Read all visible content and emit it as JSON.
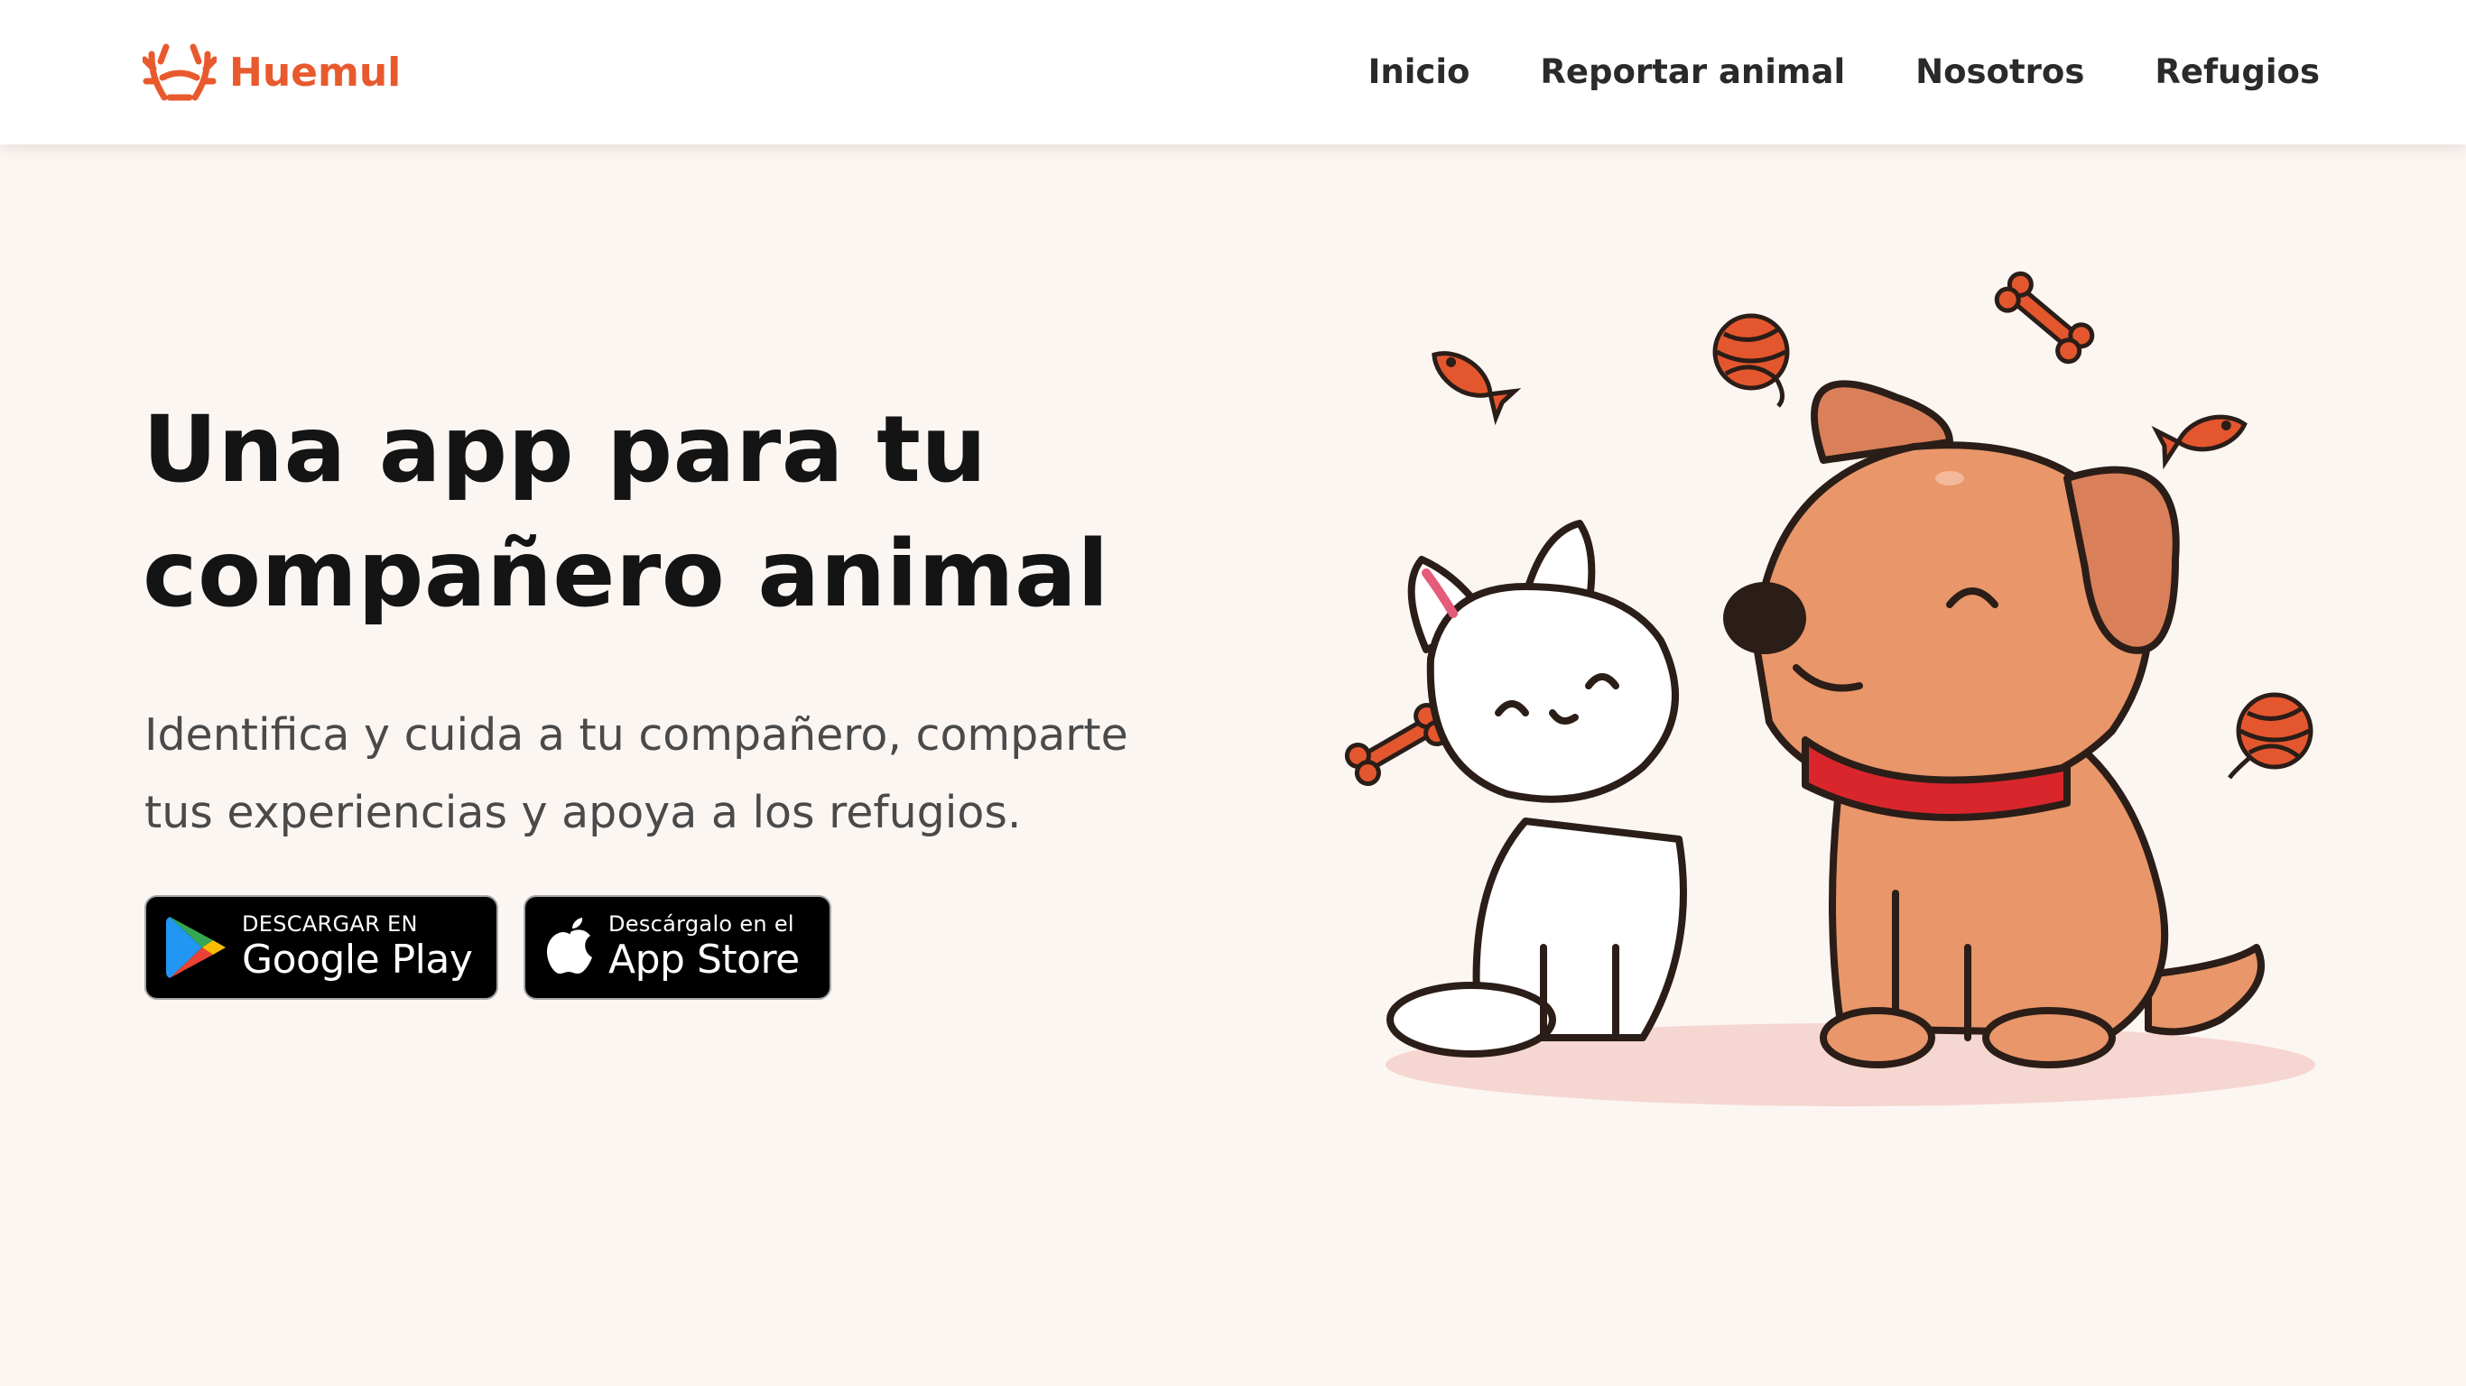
{
  "brand": {
    "name": "Huemul",
    "logo_icon": "antler-icon",
    "color": "#e85a2e"
  },
  "nav": {
    "items": [
      {
        "label": "Inicio"
      },
      {
        "label": "Reportar animal"
      },
      {
        "label": "Nosotros"
      },
      {
        "label": "Refugios"
      }
    ]
  },
  "hero": {
    "title_lines": [
      "Una app para tu",
      "compañero animal"
    ],
    "description_lines": [
      "Identifica y cuida a tu compañero, comparte",
      "tus experiencias y apoya a los refugios."
    ]
  },
  "stores": {
    "google_play": {
      "small": "DESCARGAR EN",
      "big": "Google Play",
      "icon": "google-play-icon"
    },
    "app_store": {
      "small": "Descárgalo en el",
      "big": "App Store",
      "icon": "apple-icon"
    }
  },
  "illustration": {
    "subject": "cat-and-dog-illustration",
    "colors": {
      "accent": "#e4572e",
      "dog": "#e8966a",
      "collar": "#d8262c",
      "shadow": "#f6d6d0"
    }
  }
}
